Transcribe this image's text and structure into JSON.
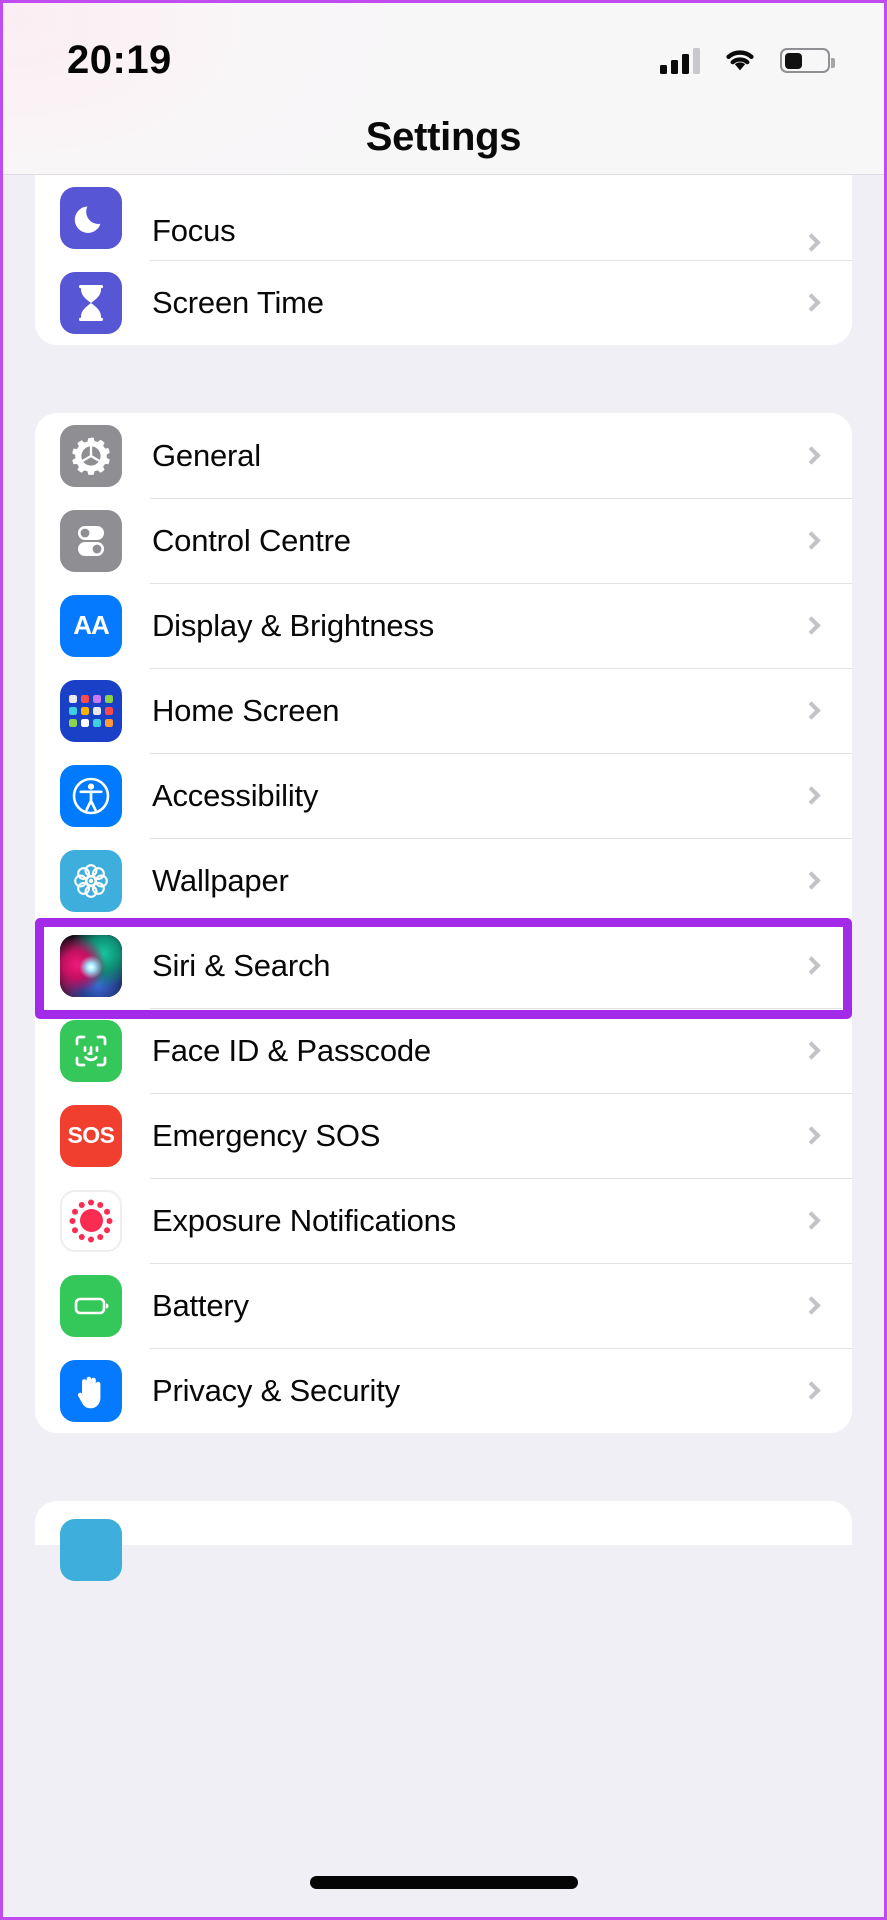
{
  "status_bar": {
    "time": "20:19",
    "signal_icon": "cellular-signal-icon",
    "signal_bars_filled": 3,
    "signal_bars_total": 4,
    "wifi_icon": "wifi-icon",
    "battery_icon": "battery-icon",
    "battery_level_percent": 38
  },
  "header": {
    "title": "Settings"
  },
  "colors": {
    "page_background": "#f0eff5",
    "card_background": "#ffffff",
    "separator": "#e2e2e5",
    "chevron": "#c2c2c7",
    "highlight_border": "#a32ae8",
    "label_text": "#080808"
  },
  "highlight": {
    "target_row": "Siri & Search",
    "border_color": "#a32ae8"
  },
  "groups": [
    {
      "id": "group-focus",
      "clipped_top": true,
      "rows": [
        {
          "label": "Focus",
          "icon": "moon-icon",
          "icon_class": "ic-focus",
          "chevron": true
        },
        {
          "label": "Screen Time",
          "icon": "hourglass-icon",
          "icon_class": "ic-screentime",
          "chevron": true
        }
      ]
    },
    {
      "id": "group-system",
      "rows": [
        {
          "label": "General",
          "icon": "gear-icon",
          "icon_class": "ic-general",
          "chevron": true
        },
        {
          "label": "Control Centre",
          "icon": "toggles-icon",
          "icon_class": "ic-control",
          "chevron": true
        },
        {
          "label": "Display & Brightness",
          "icon": "aa-text-icon",
          "icon_class": "ic-display",
          "chevron": true
        },
        {
          "label": "Home Screen",
          "icon": "app-grid-icon",
          "icon_class": "ic-home",
          "chevron": true
        },
        {
          "label": "Accessibility",
          "icon": "accessibility-person-icon",
          "icon_class": "ic-access",
          "chevron": true
        },
        {
          "label": "Wallpaper",
          "icon": "flower-icon",
          "icon_class": "ic-wallpaper",
          "chevron": true
        },
        {
          "label": "Siri & Search",
          "icon": "siri-orb-icon",
          "icon_class": "ic-siri",
          "chevron": true
        },
        {
          "label": "Face ID & Passcode",
          "icon": "face-id-icon",
          "icon_class": "ic-faceid",
          "chevron": true
        },
        {
          "label": "Emergency SOS",
          "icon": "sos-icon",
          "icon_class": "ic-sos",
          "chevron": true
        },
        {
          "label": "Exposure Notifications",
          "icon": "exposure-dots-icon",
          "icon_class": "ic-exposure",
          "chevron": true
        },
        {
          "label": "Battery",
          "icon": "battery-icon",
          "icon_class": "ic-battery",
          "chevron": true
        },
        {
          "label": "Privacy & Security",
          "icon": "hand-icon",
          "icon_class": "ic-privacy",
          "chevron": true
        }
      ]
    }
  ],
  "home_indicator": "home-indicator"
}
